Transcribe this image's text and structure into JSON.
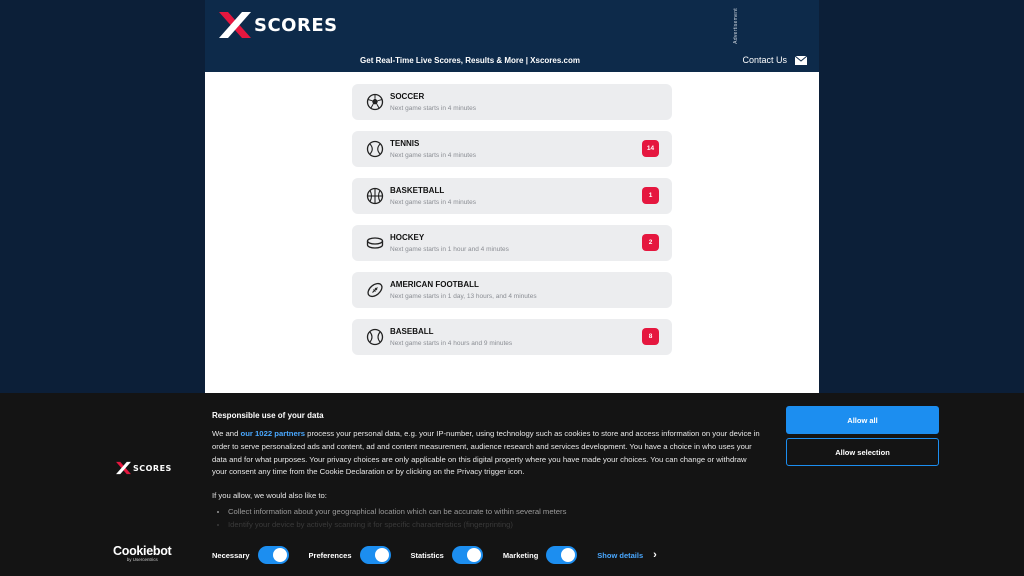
{
  "header": {
    "logo_text": "SCORES",
    "tagline": "Get Real-Time Live Scores, Results & More | Xscores.com",
    "advertisement": "Advertisement",
    "contact_label": "Contact Us"
  },
  "sports": [
    {
      "name": "SOCCER",
      "next": "Next game starts in 4 minutes",
      "badge": "",
      "icon": "soccer-ball-icon"
    },
    {
      "name": "TENNIS",
      "next": "Next game starts in 4 minutes",
      "badge": "14",
      "icon": "tennis-ball-icon"
    },
    {
      "name": "BASKETBALL",
      "next": "Next game starts in 4 minutes",
      "badge": "1",
      "icon": "basketball-icon"
    },
    {
      "name": "HOCKEY",
      "next": "Next game starts in 1 hour and 4 minutes",
      "badge": "2",
      "icon": "hockey-puck-icon"
    },
    {
      "name": "AMERICAN FOOTBALL",
      "next": "Next game starts in 1 day, 13 hours, and 4 minutes",
      "badge": "",
      "icon": "american-football-icon"
    },
    {
      "name": "BASEBALL",
      "next": "Next game starts in 4 hours and 9 minutes",
      "badge": "8",
      "icon": "baseball-icon"
    }
  ],
  "cookie": {
    "logo_text": "SCORES",
    "title": "Responsible use of your data",
    "text_before": "We and ",
    "partners_link": "our 1022 partners",
    "text_after": " process your personal data, e.g. your IP-number, using technology such as cookies to store and access information on your device in order to serve personalized ads and content, ad and content measurement, audience research and services development. You have a choice in who uses your data and for what purposes. Your privacy choices are only applicable on this digital property where you have made your choices. You can change or withdraw your consent any time from the Cookie Declaration or by clicking on the Privacy trigger icon.",
    "also_like": "If you allow, we would also like to:",
    "list": [
      "Collect information about your geographical location which can be accurate to within several meters",
      "Identify your device by actively scanning it for specific characteristics (fingerprinting)"
    ],
    "allow_all": "Allow all",
    "allow_selection": "Allow selection",
    "cookiebot_name": "Cookiebot",
    "cookiebot_sub": "by Usercentrics",
    "toggles": [
      {
        "label": "Necessary",
        "on": true
      },
      {
        "label": "Preferences",
        "on": true
      },
      {
        "label": "Statistics",
        "on": true
      },
      {
        "label": "Marketing",
        "on": true
      }
    ],
    "show_details": "Show details"
  },
  "colors": {
    "header_bg": "#0d2a4a",
    "accent_red": "#e5173f",
    "cookie_blue": "#1c8ef0"
  }
}
